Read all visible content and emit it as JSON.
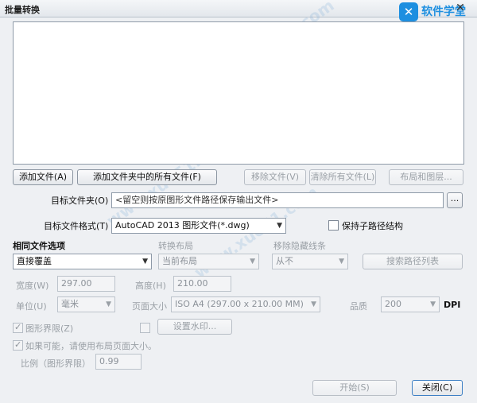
{
  "window": {
    "title": "批量转换",
    "close_glyph": "✕"
  },
  "brand": {
    "logo_glyph": "✕",
    "name": "软件学堂"
  },
  "watermark": {
    "text": "www.xue51.com"
  },
  "buttons": {
    "add_file": "添加文件(A)",
    "add_folder": "添加文件夹中的所有文件(F)",
    "remove_file": "移除文件(V)",
    "clear_all": "清除所有文件(L)",
    "layouts": "布局和图层...",
    "browse": "...",
    "search_paths": "搜索路径列表",
    "watermark_settings": "设置水印...",
    "start": "开始(S)",
    "close": "关闭(C)"
  },
  "target_folder": {
    "label": "目标文件夹(O)",
    "placeholder": "<留空则按原图形文件路径保存输出文件>"
  },
  "target_format": {
    "label": "目标文件格式(T)",
    "value": "AutoCAD 2013 图形文件(*.dwg)"
  },
  "keep_subpath": {
    "label": "保持子路径结构",
    "checked": false
  },
  "same_file": {
    "label": "相同文件选项",
    "value": "直接覆盖"
  },
  "convert_layout": {
    "label": "转换布局",
    "value": "当前布局"
  },
  "hidden_lines": {
    "label": "移除隐藏线条",
    "value": "从不"
  },
  "width": {
    "label": "宽度(W)",
    "value": "297.00"
  },
  "height": {
    "label": "高度(H)",
    "value": "210.00"
  },
  "unit": {
    "label": "单位(U)",
    "value": "毫米"
  },
  "page_size": {
    "label": "页面大小",
    "value": "ISO A4 (297.00 x 210.00 MM)"
  },
  "quality": {
    "label": "品质",
    "value": "200",
    "unit": "DPI"
  },
  "drawing_limits": {
    "label": "图形界限(Z)",
    "checked": true
  },
  "watermark_check": {
    "checked": false
  },
  "use_layout_size": {
    "label": "如果可能，请使用布局页面大小。",
    "checked": true
  },
  "scale": {
    "label": "比例（图形界限）",
    "value": "0.99"
  },
  "dropdown_arrow": "▼"
}
